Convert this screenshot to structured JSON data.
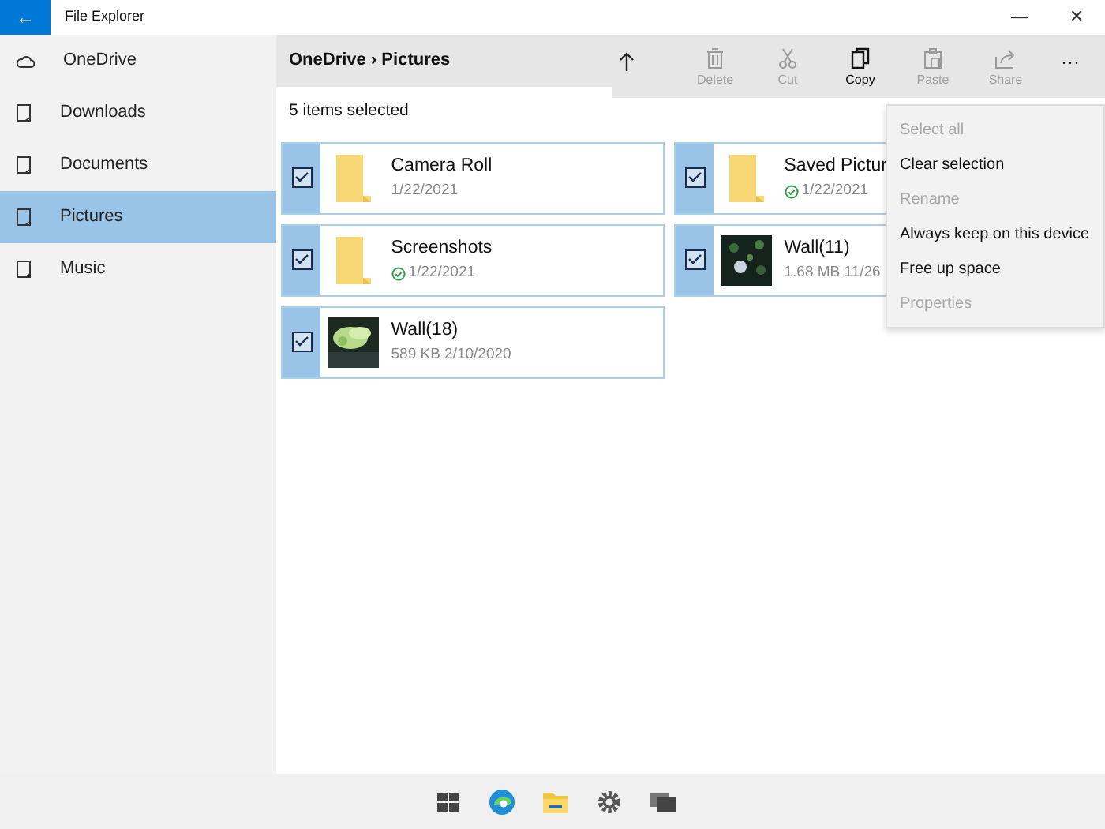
{
  "window": {
    "title": "File Explorer",
    "back": "←",
    "minimize": "—",
    "close": "✕"
  },
  "sidebar": {
    "items": [
      {
        "label": "OneDrive",
        "kind": "cloud",
        "selected": false
      },
      {
        "label": "Downloads",
        "kind": "drive",
        "selected": false
      },
      {
        "label": "Documents",
        "kind": "drive",
        "selected": false
      },
      {
        "label": "Pictures",
        "kind": "drive",
        "selected": true
      },
      {
        "label": "Music",
        "kind": "drive",
        "selected": false
      }
    ]
  },
  "breadcrumb": {
    "items": [
      "OneDrive",
      "Pictures"
    ],
    "separator": "›"
  },
  "toolbar": {
    "buttons": [
      {
        "label": "Delete",
        "kind": "delete",
        "disabled": true
      },
      {
        "label": "Cut",
        "kind": "cut",
        "disabled": true
      },
      {
        "label": "Copy",
        "kind": "copy",
        "disabled": false
      },
      {
        "label": "Paste",
        "kind": "paste",
        "disabled": true
      },
      {
        "label": "Share",
        "kind": "share",
        "disabled": true
      }
    ],
    "more": "···"
  },
  "selection_status": "5 items selected",
  "items": [
    {
      "name": "Camera Roll",
      "details": "1/22/2021",
      "kind": "folder",
      "synced": false,
      "checked": true
    },
    {
      "name": "Saved Pictur",
      "details": "1/22/2021",
      "kind": "folder",
      "synced": true,
      "checked": true
    },
    {
      "name": "Screenshots",
      "details": "1/22/2021",
      "kind": "folder",
      "synced": true,
      "checked": true
    },
    {
      "name": "Wall(11)",
      "details": "1.68 MB 11/26",
      "kind": "picture",
      "synced": false,
      "checked": true
    },
    {
      "name": "Wall(18)",
      "details": "589 KB 2/10/2020",
      "kind": "picture",
      "synced": false,
      "checked": true
    }
  ],
  "context_menu": [
    {
      "label": "Select all",
      "disabled": true
    },
    {
      "label": "Clear selection",
      "disabled": false
    },
    {
      "label": "Rename",
      "disabled": true
    },
    {
      "label": "Always keep on this device",
      "disabled": false
    },
    {
      "label": "Free up space",
      "disabled": false
    },
    {
      "label": "Properties",
      "disabled": true
    }
  ],
  "taskbar": [
    {
      "kind": "start"
    },
    {
      "kind": "browser"
    },
    {
      "kind": "folder"
    },
    {
      "kind": "settings"
    },
    {
      "kind": "taskview"
    }
  ]
}
